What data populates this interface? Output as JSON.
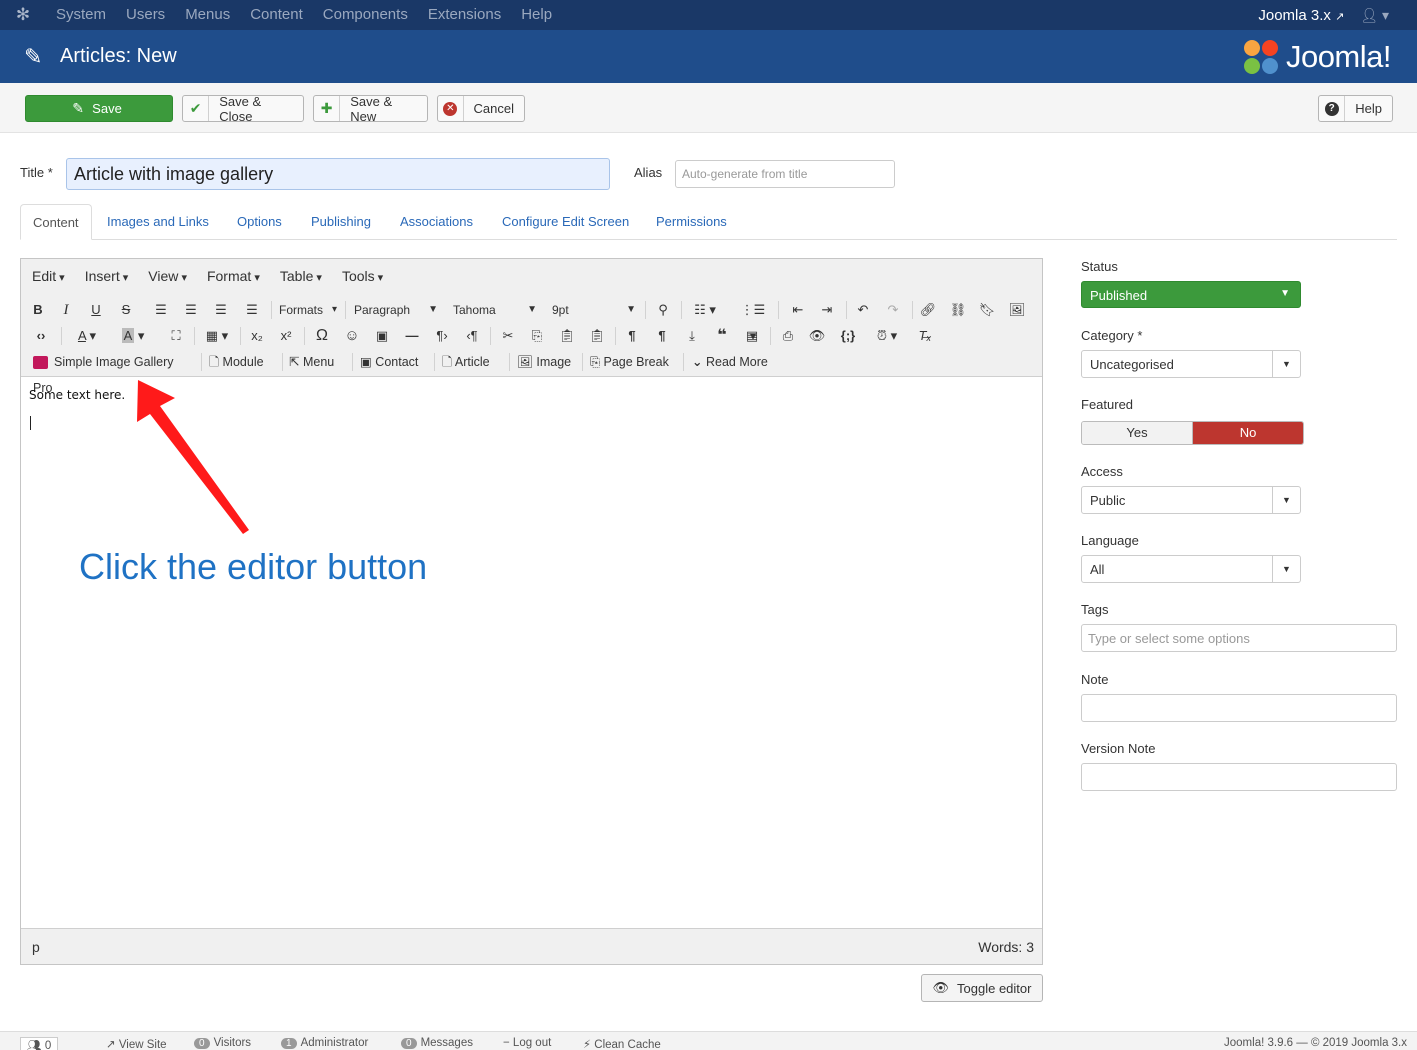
{
  "topnav": {
    "items": [
      "System",
      "Users",
      "Menus",
      "Content",
      "Components",
      "Extensions",
      "Help"
    ],
    "site_link": "Joomla 3.x",
    "site_link_icon": "external-link-icon",
    "user_icon": "user-icon"
  },
  "header": {
    "title": "Articles: New",
    "brand": "Joomla!"
  },
  "toolbar": {
    "save": "Save",
    "save_close": "Save & Close",
    "save_new": "Save & New",
    "cancel": "Cancel",
    "help": "Help"
  },
  "form": {
    "title_label": "Title *",
    "title_value": "Article with image gallery",
    "alias_label": "Alias",
    "alias_placeholder": "Auto-generate from title"
  },
  "tabs": [
    "Content",
    "Images and Links",
    "Options",
    "Publishing",
    "Associations",
    "Configure Edit Screen",
    "Permissions"
  ],
  "editor": {
    "menus": [
      "Edit",
      "Insert",
      "View",
      "Format",
      "Table",
      "Tools"
    ],
    "formats_label": "Formats",
    "block_format": "Paragraph",
    "font_family": "Tahoma",
    "font_size": "9pt",
    "buttons": [
      "Simple Image Gallery Pro",
      "Module",
      "Menu",
      "Contact",
      "Article",
      "Image",
      "Page Break",
      "Read More"
    ],
    "content": "Some text here.",
    "status_path": "p",
    "word_count": "Words: 3",
    "toggle": "Toggle editor"
  },
  "annotation": "Click the editor button",
  "sidebar": {
    "status_label": "Status",
    "status_value": "Published",
    "category_label": "Category *",
    "category_value": "Uncategorised",
    "featured_label": "Featured",
    "featured_yes": "Yes",
    "featured_no": "No",
    "access_label": "Access",
    "access_value": "Public",
    "language_label": "Language",
    "language_value": "All",
    "tags_label": "Tags",
    "tags_placeholder": "Type or select some options",
    "note_label": "Note",
    "version_note_label": "Version Note"
  },
  "footer": {
    "counter": "0",
    "view_site": "View Site",
    "visitors_count": "0",
    "visitors": "Visitors",
    "admin_count": "1",
    "administrator": "Administrator",
    "messages_count": "0",
    "messages": "Messages",
    "logout": "Log out",
    "clean_cache": "Clean Cache",
    "version": "Joomla! 3.9.6  —  © 2019 Joomla 3.x"
  },
  "colors": {
    "topnav": "#1a3867",
    "header": "#1f4d8b",
    "success": "#3c9a3c",
    "danger": "#bd362f",
    "link": "#2a69b8",
    "annotation": "#1f72c4",
    "arrow": "#ff1a1a"
  }
}
